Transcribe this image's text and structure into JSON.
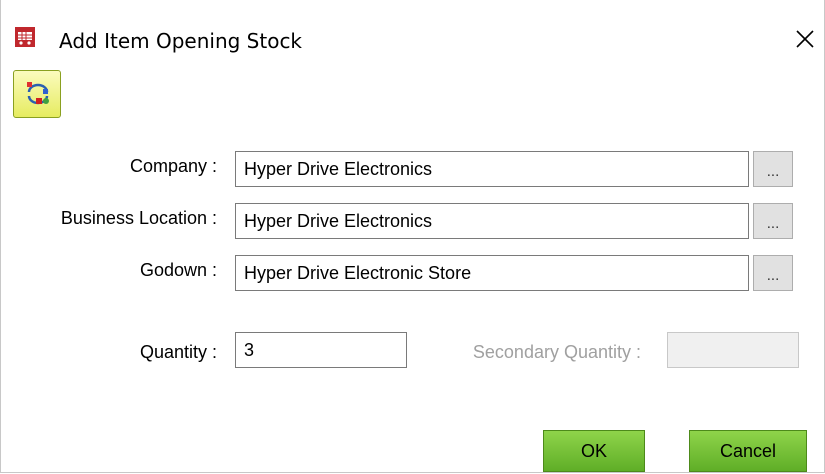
{
  "window": {
    "title": "Add Item Opening Stock",
    "app_icon": "shopping-cart-icon",
    "close_icon": "close-icon"
  },
  "toolbar": {
    "icon": "refresh-sync-icon"
  },
  "form": {
    "company_label": "Company :",
    "company_value": "Hyper Drive Electronics",
    "business_location_label": "Business Location :",
    "business_location_value": "Hyper Drive Electronics",
    "godown_label": "Godown :",
    "godown_value": "Hyper Drive Electronic Store",
    "browse_label": "...",
    "quantity_label": "Quantity :",
    "quantity_value": "3",
    "secondary_quantity_label": "Secondary Quantity :",
    "secondary_quantity_value": ""
  },
  "actions": {
    "ok_label": "OK",
    "cancel_label": "Cancel"
  },
  "colors": {
    "button_green": "#6fbf2f",
    "toolbar_yellow": "#eef07a"
  }
}
